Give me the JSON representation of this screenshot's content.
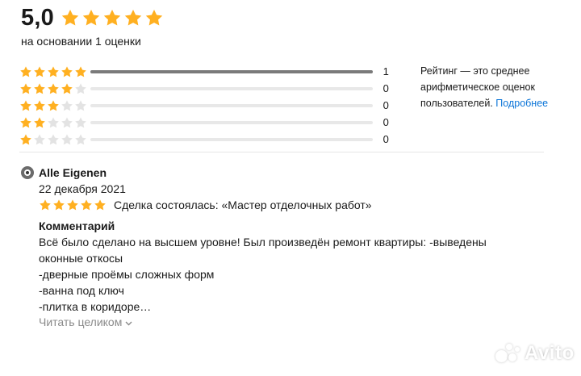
{
  "summary": {
    "rating_value": "5,0",
    "stars": 5,
    "based_on": "на основании 1 оценки"
  },
  "histogram": [
    {
      "stars": 5,
      "count": "1",
      "fraction": 1.0
    },
    {
      "stars": 4,
      "count": "0",
      "fraction": 0
    },
    {
      "stars": 3,
      "count": "0",
      "fraction": 0
    },
    {
      "stars": 2,
      "count": "0",
      "fraction": 0
    },
    {
      "stars": 1,
      "count": "0",
      "fraction": 0
    }
  ],
  "note": {
    "text": "Рейтинг — это среднее арифметическое оценок пользователей.",
    "link_label": "Подробнее"
  },
  "review": {
    "author": "Alle Eigenen",
    "date": "22 декабря 2021",
    "stars": 5,
    "deal_text": "Сделка состоялась: «Мастер отделочных работ»",
    "comment_title": "Комментарий",
    "comment_lines": [
      "Всё было сделано на высшем уровне! Был произведён ремонт квартиры: -выведены",
      "оконные откосы",
      "-дверные проёмы сложных форм",
      "-ванна под ключ",
      "-плитка в коридоре…"
    ],
    "read_more": "Читать целиком"
  },
  "watermark": {
    "text": "Avito"
  },
  "colors": {
    "star_filled": "#ffb021",
    "star_empty": "#e3e3e3",
    "bar_fill": "#7a7a7a",
    "bar_track": "#e8e8e8",
    "link": "#0a74d8"
  }
}
